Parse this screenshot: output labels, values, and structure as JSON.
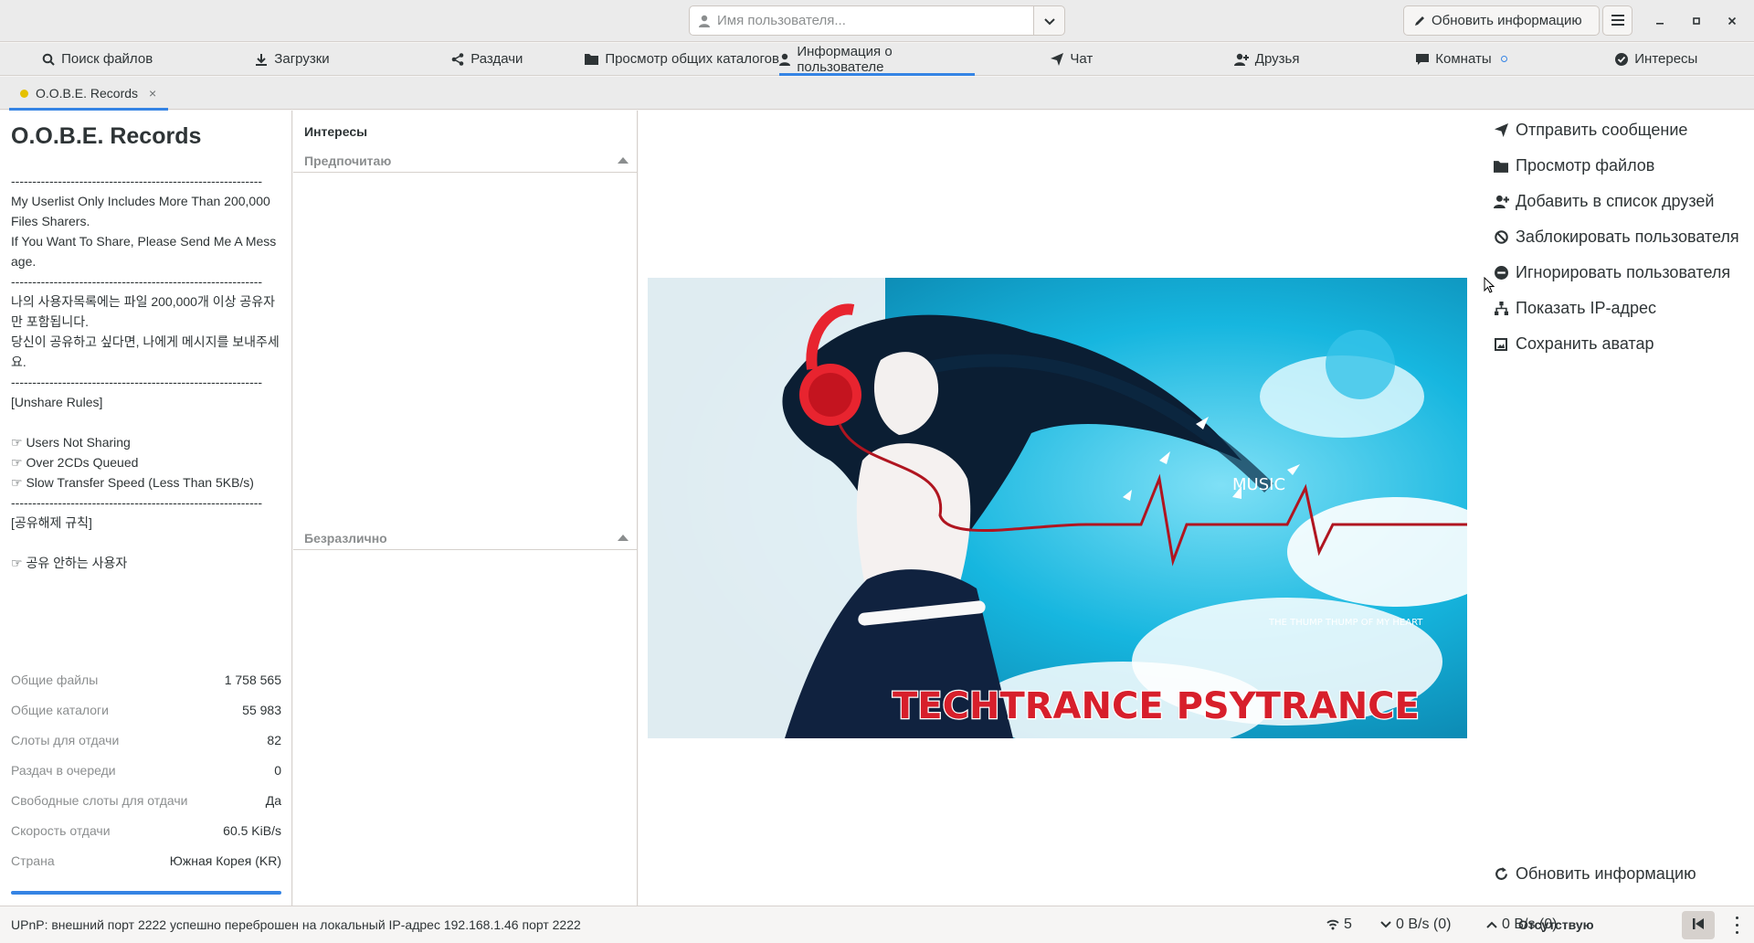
{
  "header": {
    "username_placeholder": "Имя пользователя...",
    "refresh_label": "Обновить информацию"
  },
  "main_tabs": [
    {
      "label": "Поиск файлов",
      "icon": "search-icon"
    },
    {
      "label": "Загрузки",
      "icon": "download-icon"
    },
    {
      "label": "Раздачи",
      "icon": "share-icon"
    },
    {
      "label": "Просмотр общих каталогов",
      "icon": "folder-icon"
    },
    {
      "label": "Информация о пользователе",
      "icon": "user-icon",
      "active": true
    },
    {
      "label": "Чат",
      "icon": "send-icon"
    },
    {
      "label": "Друзья",
      "icon": "user-plus-icon"
    },
    {
      "label": "Комнаты",
      "icon": "chat-bubble-icon"
    },
    {
      "label": "Интересы",
      "icon": "check-circle-icon"
    }
  ],
  "user_tab": {
    "label": "O.O.B.E. Records",
    "close": "×",
    "status_color": "#e5c100"
  },
  "profile": {
    "nickname": "O.O.B.E. Records",
    "description": "-----------------------------------------------------------\nMy Userlist Only Includes More Than 200,000 Files Sharers.\nIf You Want To Share, Please Send Me A Message.\n-----------------------------------------------------------\n나의 사용자목록에는 파일 200,000개 이상 공유자만 포함됩니다.\n당신이 공유하고 싶다면, 나에게 메시지를 보내주세요.\n-----------------------------------------------------------\n[Unshare Rules]\n\n☞ Users Not Sharing\n☞ Over 2CDs Queued\n☞ Slow Transfer Speed (Less Than 5KB/s)\n-----------------------------------------------------------\n[공유해제 규칙]\n\n☞ 공유 안하는 사용자",
    "stats": [
      {
        "label": "Общие файлы",
        "value": "1 758 565"
      },
      {
        "label": "Общие каталоги",
        "value": "55 983"
      },
      {
        "label": "Слоты для отдачи",
        "value": "82"
      },
      {
        "label": "Раздач в очереди",
        "value": "0"
      },
      {
        "label": "Свободные слоты для отдачи",
        "value": "Да"
      },
      {
        "label": "Скорость отдачи",
        "value": "60.5 KiB/s"
      },
      {
        "label": "Страна",
        "value": "Южная Корея (KR)"
      }
    ]
  },
  "interests": {
    "title": "Интересы",
    "liked_header": "Предпочитаю",
    "neutral_header": "Безразлично"
  },
  "avatar": {
    "text_big": "TECHTRANCE  PSYTRANCE",
    "text_music": "MUSIC",
    "text_small": "THE THUMP THUMP OF MY HEART"
  },
  "actions": {
    "send_message": "Отправить сообщение",
    "browse_files": "Просмотр файлов",
    "add_friend": "Добавить в список друзей",
    "ban_user": "Заблокировать пользователя",
    "ignore_user": "Игнорировать пользователя",
    "show_ip": "Показать IP-адрес",
    "save_avatar": "Сохранить аватар",
    "refresh": "Обновить информацию"
  },
  "statusbar": {
    "message": "UPnP: внешний порт 2222 успешно переброшен на локальный IP-адрес 192.168.1.46 порт 2222",
    "connections": "5",
    "download": "0 B/s (0)",
    "upload": "0 B/s (0)",
    "away_status": "Отсутствую"
  },
  "colors": {
    "accent": "#3584e4",
    "away_dot": "#e5c100"
  }
}
